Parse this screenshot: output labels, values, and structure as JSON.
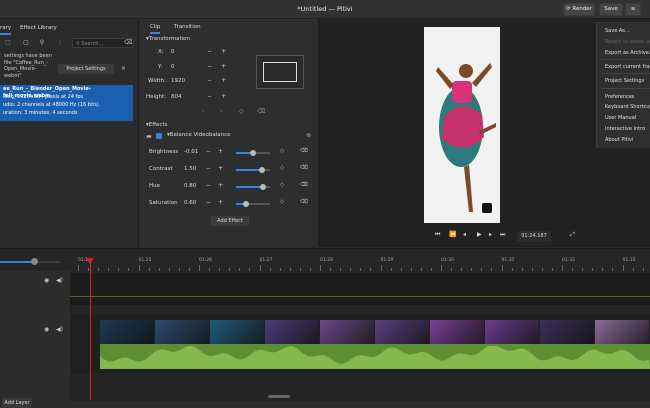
{
  "header": {
    "title": "*Untitled — Pitivi",
    "render_label": "Render",
    "save_label": "Save",
    "menu_icon": "hamburger-menu-icon"
  },
  "library": {
    "tab_media": "rary",
    "tab_effects": "Effect Library",
    "search_placeholder": "Search...",
    "notify_lines": [
      "settings have been",
      "file \"Coffee_Run_-",
      "Open_Movie-",
      "webm\""
    ],
    "project_settings_label": "Project Settings",
    "clip_info": {
      "name": "ee_Run_-_Blender_Open_Movie-full_movie.webm",
      "video": "ideo: 1920×804 pixels at 24 fps",
      "audio": "udio: 2 channels at 48000 Hz (16 bits)",
      "duration": "uration: 3 minutes, 4 seconds"
    }
  },
  "clip_props": {
    "tab_clip": "Clip",
    "tab_transition": "Transition",
    "transformation_title": "Transformation",
    "fields": [
      {
        "label": "X:",
        "value": "0"
      },
      {
        "label": "Y:",
        "value": "0"
      },
      {
        "label": "Width:",
        "value": "1920"
      },
      {
        "label": "Height:",
        "value": "804"
      }
    ],
    "effects_title": "Effects",
    "effect_name": "Balance Videobalance",
    "effect_params": [
      {
        "label": "Brightness",
        "value": "-0.01",
        "level": 0.5
      },
      {
        "label": "Contrast",
        "value": "1.50",
        "level": 0.75
      },
      {
        "label": "Hue",
        "value": "0.80",
        "level": 0.8
      },
      {
        "label": "Saturation",
        "value": "0.60",
        "level": 0.3
      }
    ],
    "add_effect_label": "Add Effect"
  },
  "viewer": {
    "timecode": "01:24.187"
  },
  "menu": {
    "items": [
      "Save As...",
      "Revert to saved vers",
      "Export as Archive...",
      "Export current fram",
      "Project Settings",
      "Preferences",
      "Keyboard Shortcut",
      "User Manual",
      "Interactive Intro",
      "About Pitivi"
    ]
  },
  "timeline": {
    "ticks": [
      "01:24",
      "01:25",
      "01:26",
      "01:27",
      "01:28",
      "01:29",
      "01:30",
      "01:31",
      "01:32",
      "01:33"
    ],
    "add_layer_label": "Add Layer"
  },
  "colors": {
    "accent": "#3584e4",
    "playhead": "#e01b24",
    "audio": "#5e8e32",
    "selection": "#1b5fb0"
  }
}
